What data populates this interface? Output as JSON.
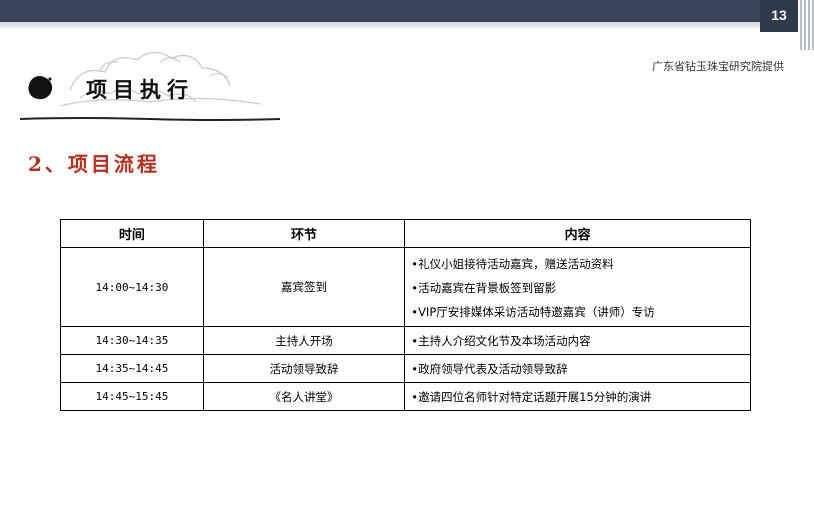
{
  "slide": {
    "page_number": "13",
    "provider": "广东省钻玉珠宝研究院提供",
    "section_title": "项目执行",
    "subtitle": "2、项目流程"
  },
  "table": {
    "headers": [
      "时间",
      "环节",
      "内容"
    ],
    "rows": [
      {
        "time": "14:00~14:30",
        "segment": "嘉宾签到",
        "content": [
          "•礼仪小姐接待活动嘉宾，赠送活动资料",
          "•活动嘉宾在背景板签到留影",
          "•VIP厅安排媒体采访活动特邀嘉宾（讲师）专访"
        ]
      },
      {
        "time": "14:30~14:35",
        "segment": "主持人开场",
        "content": [
          "•主持人介绍文化节及本场活动内容"
        ]
      },
      {
        "time": "14:35~14:45",
        "segment": "活动领导致辞",
        "content": [
          "•政府领导代表及活动领导致辞"
        ]
      },
      {
        "time": "14:45~15:45",
        "segment": "《名人讲堂》",
        "content": [
          "•邀请四位名师针对特定话题开展15分钟的演讲"
        ]
      }
    ]
  }
}
